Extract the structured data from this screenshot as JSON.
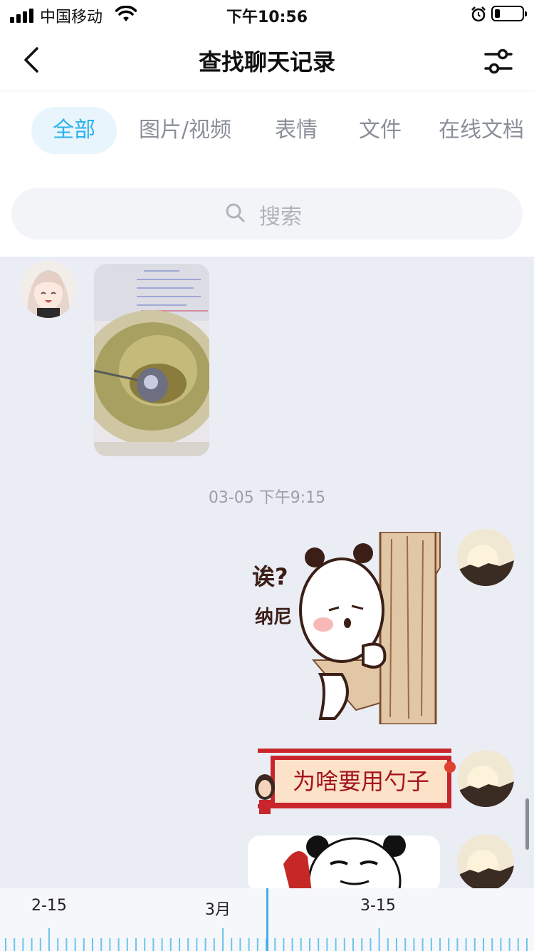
{
  "status_bar": {
    "carrier": "中国移动",
    "time": "下午10:56"
  },
  "nav": {
    "title": "查找聊天记录"
  },
  "tabs": [
    {
      "label": "全部",
      "active": true
    },
    {
      "label": "图片/视频",
      "active": false
    },
    {
      "label": "表情",
      "active": false
    },
    {
      "label": "文件",
      "active": false
    },
    {
      "label": "在线文档",
      "active": false
    }
  ],
  "search": {
    "placeholder": "搜索"
  },
  "chat": {
    "timestamp": "03-05 下午9:15",
    "sticker_texts": [
      "诶?",
      "纳尼"
    ],
    "banner_text": "为啥要用勺子"
  },
  "timeline": {
    "labels": [
      "2-15",
      "3月",
      "3-15"
    ]
  },
  "colors": {
    "accent": "#2bb0ee",
    "chat_bg": "#ebedf5",
    "tab_active_bg": "#e8f5fc",
    "banner_red": "#c8262c"
  }
}
